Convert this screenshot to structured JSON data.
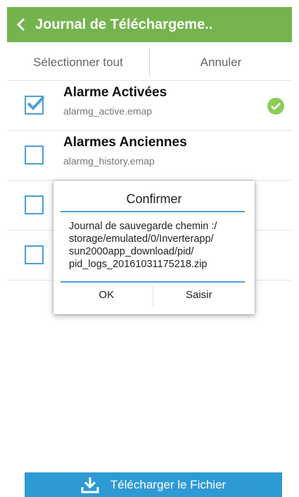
{
  "header": {
    "title": "Journal de Téléchargeme..",
    "back_icon": "chevron-left-icon"
  },
  "actions": {
    "select_all": "Sélectionner tout",
    "cancel": "Annuler"
  },
  "files": [
    {
      "title": "Alarme Activées",
      "filename": "alarmg_active.emap",
      "checked": true,
      "status_icon": "check-circle-icon"
    },
    {
      "title": "Alarmes Anciennes",
      "filename": "alarmg_history.emap",
      "checked": false
    },
    {
      "title": "",
      "filename": "",
      "checked": false
    },
    {
      "title": "",
      "filename": "",
      "checked": false
    }
  ],
  "dialog": {
    "title": "Confirmer",
    "message_lines": [
      "Journal de sauvegarde chemin :/",
      "storage/emulated/0/Inverterapp/",
      "sun2000app_download/pid/",
      "pid_logs_20161031175218.zip"
    ],
    "ok_label": "OK",
    "open_label": "Saisir"
  },
  "download": {
    "label": "Télécharger le Fichier",
    "icon": "download-icon"
  },
  "colors": {
    "header": "#74b44e",
    "accent": "#4a9fd6",
    "download": "#2e9ad4",
    "success": "#8dcb5c"
  }
}
